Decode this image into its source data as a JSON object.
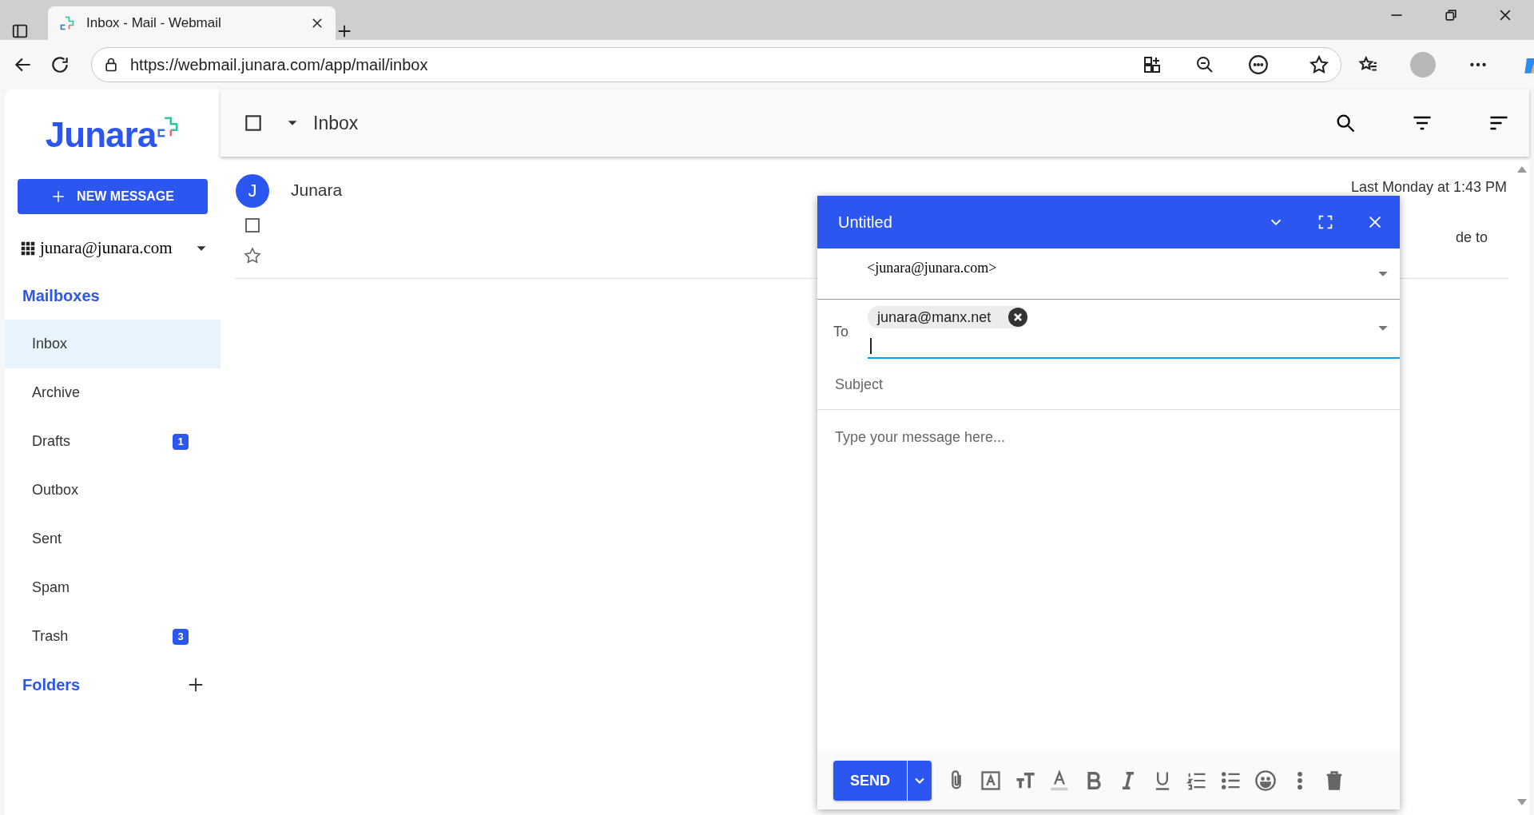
{
  "browser": {
    "tab_title": "Inbox - Mail - Webmail",
    "url": "https://webmail.junara.com/app/mail/inbox"
  },
  "sidebar": {
    "logo": "Junara",
    "new_message": "NEW MESSAGE",
    "account": "junara@junara.com",
    "mailboxes_heading": "Mailboxes",
    "items": [
      {
        "label": "Inbox",
        "selected": true
      },
      {
        "label": "Archive",
        "selected": false
      },
      {
        "label": "Drafts",
        "badge": "1",
        "selected": false
      },
      {
        "label": "Outbox",
        "selected": false
      },
      {
        "label": "Sent",
        "selected": false
      },
      {
        "label": "Spam",
        "selected": false
      },
      {
        "label": "Trash",
        "badge": "3",
        "selected": false
      }
    ],
    "folders_heading": "Folders"
  },
  "toolbar": {
    "title": "Inbox"
  },
  "messages": [
    {
      "avatar": "J",
      "sender": "Junara",
      "date": "Last Monday at 1:43 PM",
      "preview": "de to",
      "checked": false,
      "starred": false
    }
  ],
  "compose": {
    "title": "Untitled",
    "from": "<junara@junara.com>",
    "to_label": "To",
    "recipients": [
      "junara@manx.net"
    ],
    "subject_placeholder": "Subject",
    "body_placeholder": "Type your message here...",
    "send": "SEND"
  }
}
